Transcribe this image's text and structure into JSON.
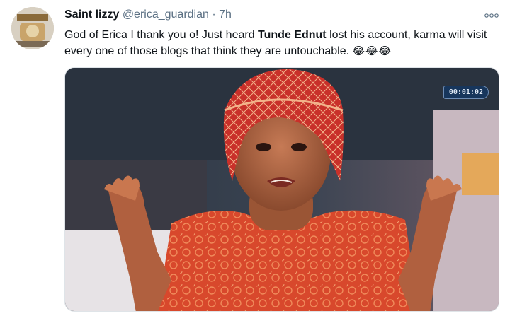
{
  "tweet": {
    "author_name": "Saint lizzy",
    "handle": "@erica_guardian",
    "separator": "·",
    "time": "7h",
    "more_icon": "more-options-icon",
    "text_before": "God of Erica I thank you o! Just heard ",
    "text_bold": "Tunde Ednut",
    "text_after": " lost his account, karma will visit every one of those blogs that think they are untouchable. ",
    "emojis": "😂😂😂"
  },
  "media": {
    "timer": "00:01:02",
    "description_icon": "photo-woman-red-gele"
  },
  "colors": {
    "text": "#0f1419",
    "secondary": "#5b7083",
    "dress_red": "#d8482c",
    "timer_bg": "#17365c"
  }
}
